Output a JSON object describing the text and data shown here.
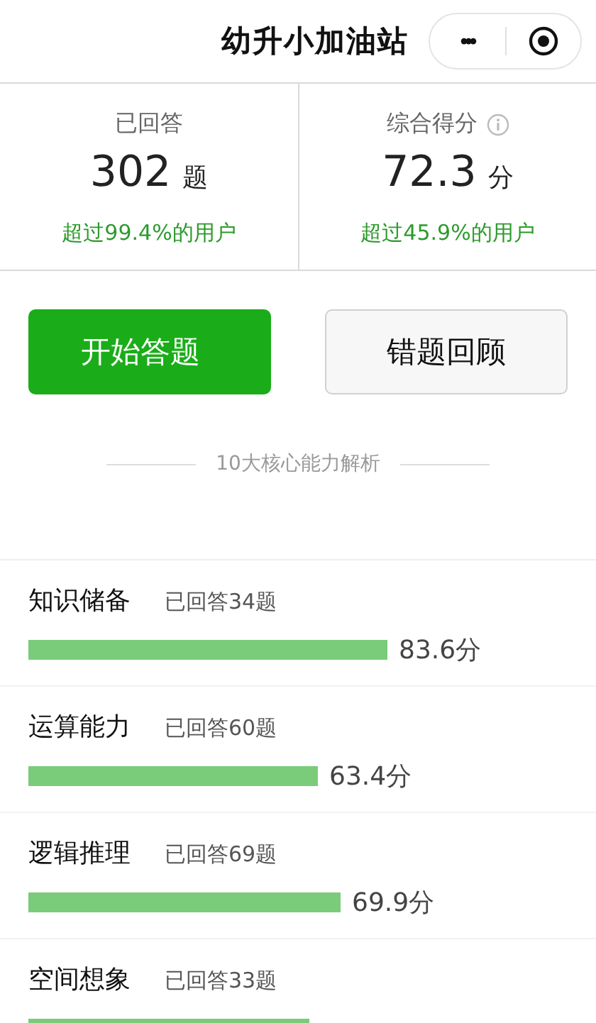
{
  "nav": {
    "title": "幼升小加油站",
    "more": "•••"
  },
  "stats": [
    {
      "label": "已回答",
      "value": "302",
      "unit": "题",
      "note": "超过99.4%的用户"
    },
    {
      "label": "综合得分",
      "value": "72.3",
      "unit": "分",
      "note": "超过45.9%的用户",
      "info": true
    }
  ],
  "buttons": [
    {
      "label": "开始答题",
      "kind": "primary"
    },
    {
      "label": "错题回顾",
      "kind": "secondary"
    }
  ],
  "section_title": "10大核心能力解析",
  "abilities": [
    {
      "name": "知识储备",
      "answered": "已回答34题",
      "reading": "83.6分"
    },
    {
      "name": "运算能力",
      "answered": "已回答60题",
      "reading": "63.4分"
    },
    {
      "name": "逻辑推理",
      "answered": "已回答69题",
      "reading": "69.9分"
    },
    {
      "name": "空间想象",
      "answered": "已回答33题"
    }
  ]
}
